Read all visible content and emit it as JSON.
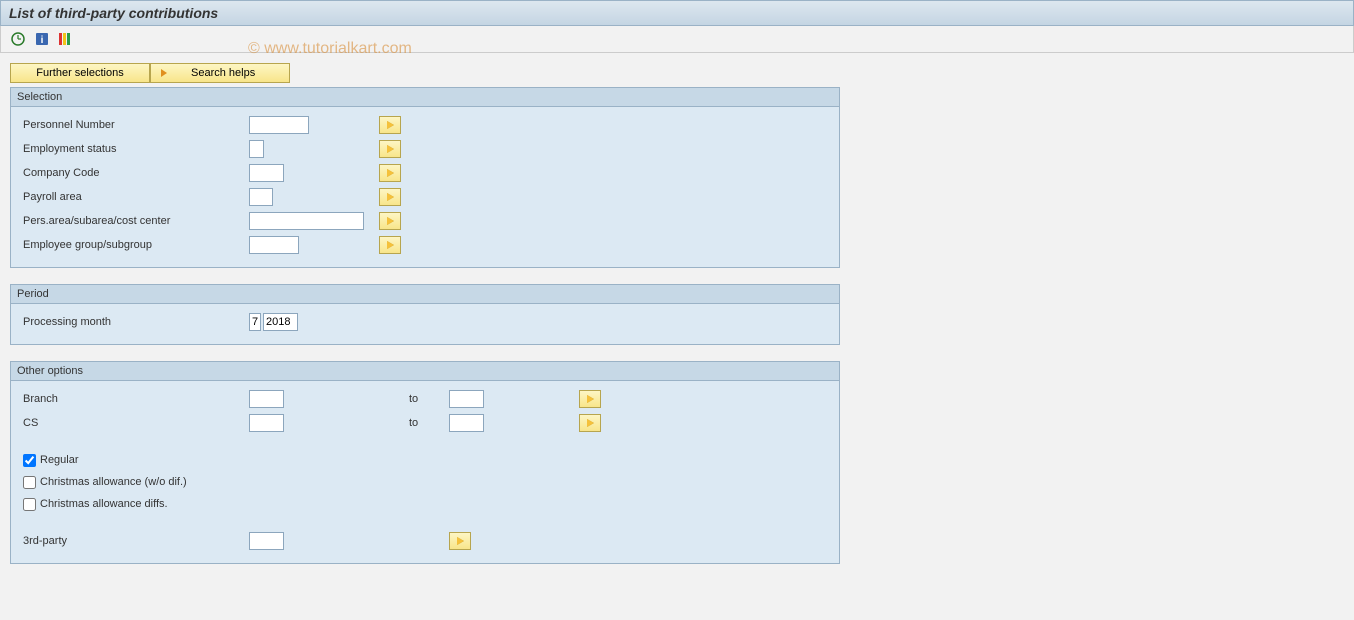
{
  "title": "List of third-party contributions",
  "watermark": "© www.tutorialkart.com",
  "topButtons": {
    "further": "Further selections",
    "search": "Search helps"
  },
  "selection": {
    "title": "Selection",
    "rows": {
      "personnel": "Personnel Number",
      "employment": "Employment status",
      "company": "Company Code",
      "payroll": "Payroll area",
      "pers_area": "Pers.area/subarea/cost center",
      "emp_group": "Employee group/subgroup"
    }
  },
  "period": {
    "title": "Period",
    "label": "Processing month",
    "month": "7",
    "year": "2018"
  },
  "other": {
    "title": "Other options",
    "branch": "Branch",
    "cs": "CS",
    "to": "to",
    "regular": "Regular",
    "xmas1": "Christmas allowance (w/o dif.)",
    "xmas2": "Christmas allowance diffs.",
    "third_party": "3rd-party"
  }
}
